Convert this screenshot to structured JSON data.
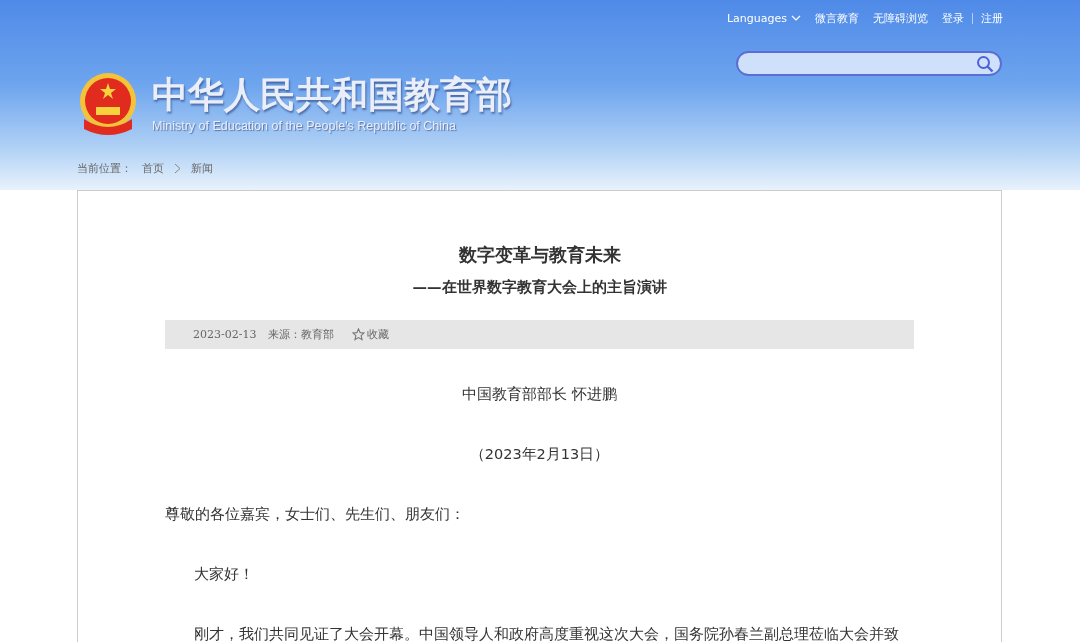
{
  "header": {
    "nav": [
      {
        "label": "Languages",
        "kind": "dropdown"
      },
      {
        "label": "微言教育",
        "kind": "link"
      },
      {
        "label": "无障碍浏览",
        "kind": "link"
      },
      {
        "label": "登录",
        "kind": "link"
      },
      {
        "label": "注册",
        "kind": "link"
      }
    ],
    "logo": {
      "title": "中华人民共和国教育部",
      "subtitle": "Ministry of Education of the People's Republic of China"
    }
  },
  "breadcrumb": {
    "label": "当前位置：",
    "items": [
      "首页",
      "新闻"
    ]
  },
  "article": {
    "title": "数字变革与教育未来",
    "subtitle": "——在世界数字教育大会上的主旨演讲",
    "meta": {
      "date": "2023-02-13",
      "source": "来源：教育部",
      "favorite": "收藏"
    },
    "paragraphs": [
      {
        "text": "中国教育部部长 怀进鹏",
        "kind": "center"
      },
      {
        "text": "（2023年2月13日）",
        "kind": "center"
      },
      {
        "text": "尊敬的各位嘉宾，女士们、先生们、朋友们：",
        "kind": "plain"
      },
      {
        "text": "大家好！",
        "kind": "indent"
      },
      {
        "text": "刚才，我们共同见证了大会开幕。中国领导人和政府高度重视这次大会，国务院孙春兰副总理莅临大会并致",
        "kind": "indent"
      }
    ]
  }
}
